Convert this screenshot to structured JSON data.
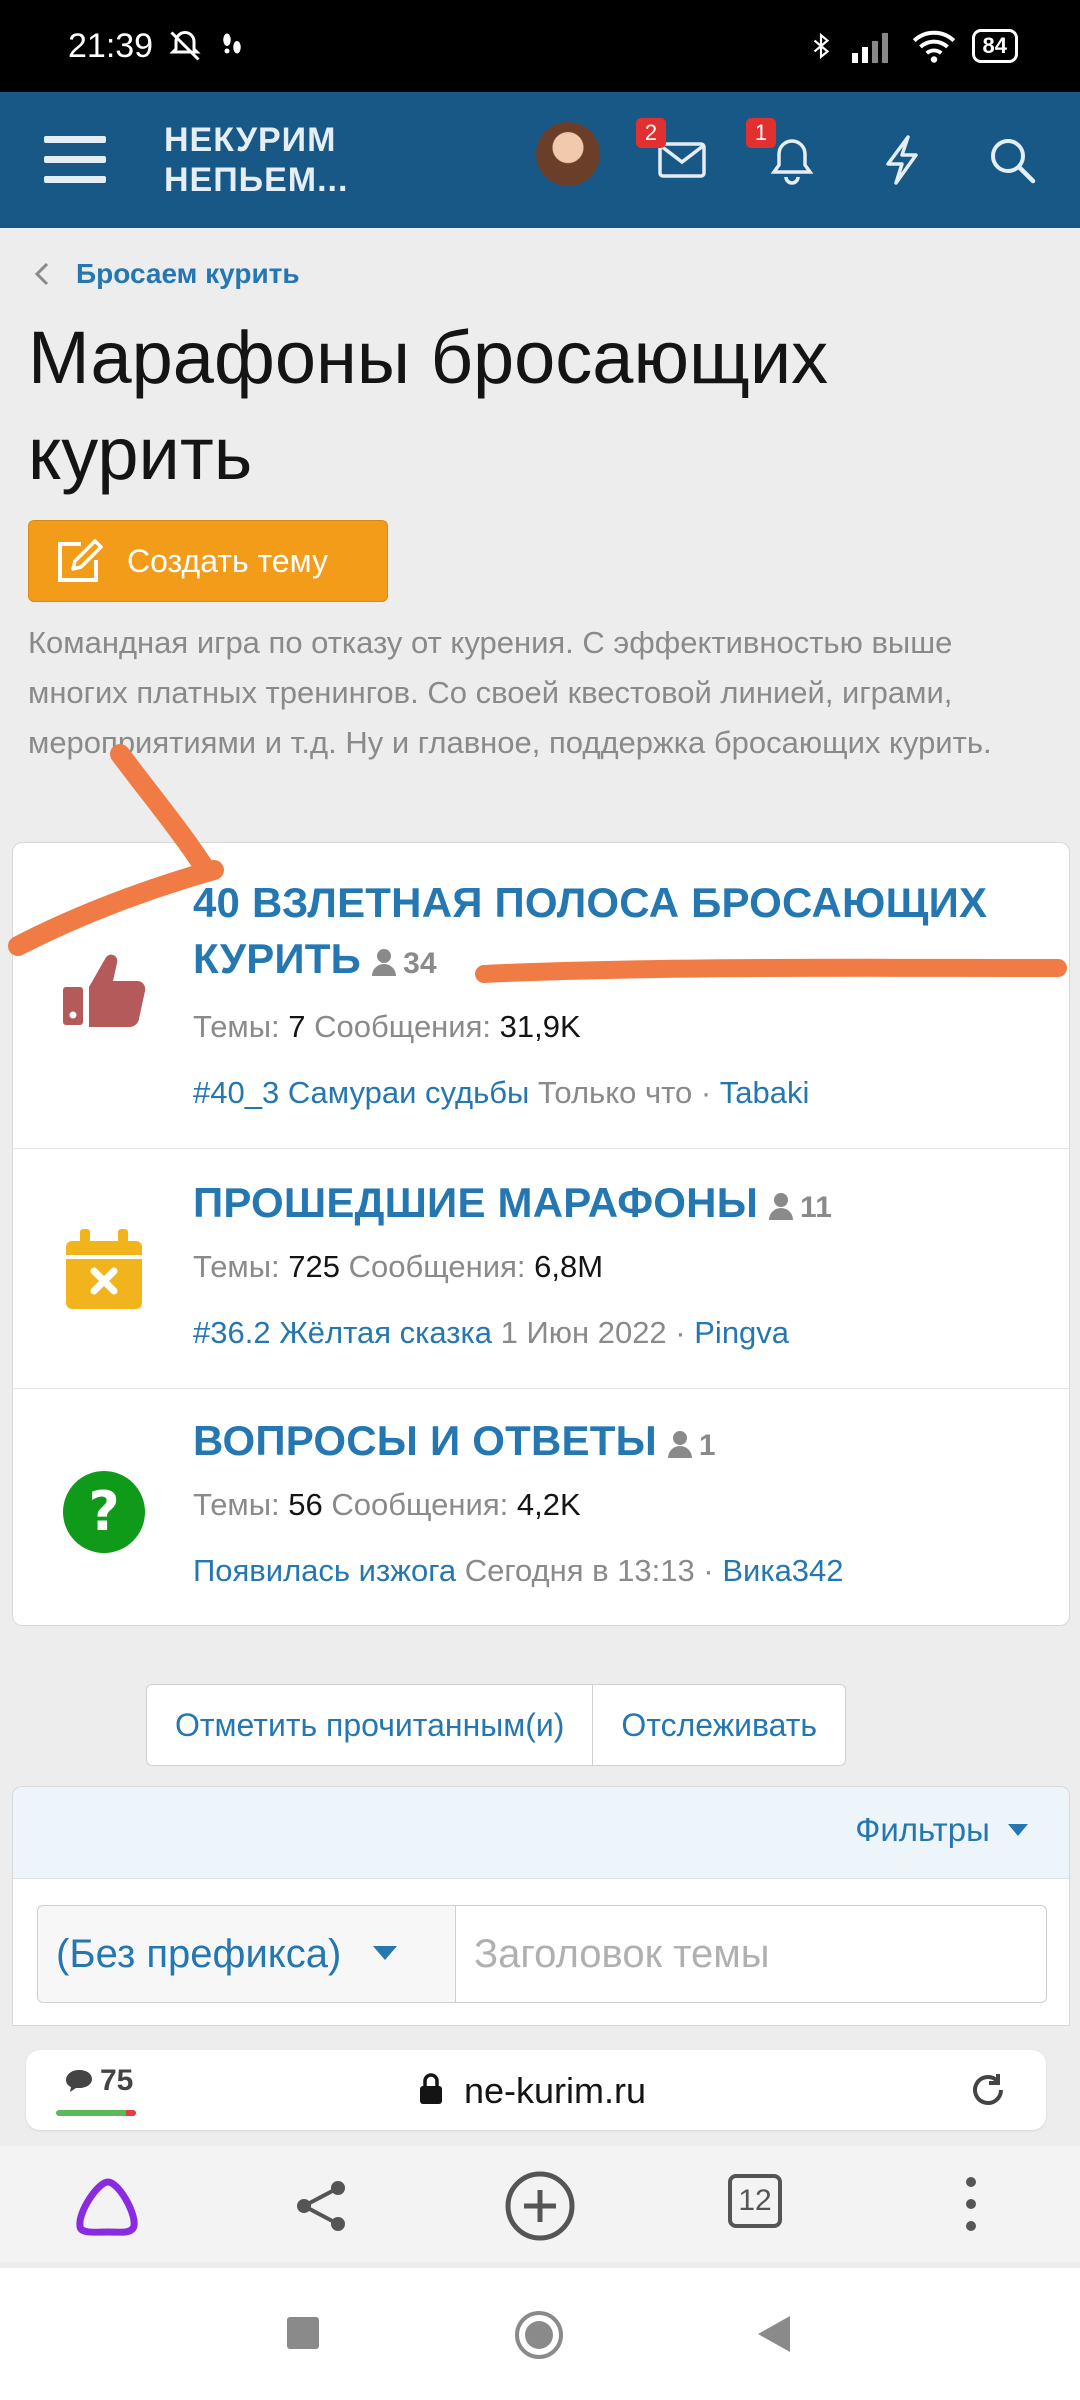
{
  "status_bar": {
    "time": "21:39",
    "battery": "84"
  },
  "header": {
    "logo_line1": "НЕКУРИМ",
    "logo_line2": "НЕПЬЕМ...",
    "messages_badge": "2",
    "alerts_badge": "1"
  },
  "breadcrumb": {
    "label": "Бросаем курить"
  },
  "page": {
    "title": "Марафоны бросающих курить",
    "create_button": "Создать тему",
    "description": "Командная игра по отказу от курения. С эффективностью выше многих платных тренингов. Со своей квестовой линией, играми, мероприятиями и т.д. Ну и главное, поддержка бросающих курить."
  },
  "nodes": [
    {
      "title": "40 ВЗЛЕТНАЯ ПОЛОСА БРОСАЮЩИХ КУРИТЬ",
      "users": "34",
      "stats_label_threads": "Темы:",
      "threads": "7",
      "stats_label_messages": "Сообщения:",
      "messages": "31,9K",
      "last_thread": "#40_3 Самураи судьбы",
      "last_time": "Только что",
      "last_user": "Tabaki",
      "icon": "thumbs-up-icon"
    },
    {
      "title": "ПРОШЕДШИЕ МАРАФОНЫ",
      "users": "11",
      "stats_label_threads": "Темы:",
      "threads": "725",
      "stats_label_messages": "Сообщения:",
      "messages": "6,8M",
      "last_thread": "#36.2 Жёлтая сказка",
      "last_time": "1 Июн 2022",
      "last_user": "Pingva",
      "icon": "calendar-x-icon"
    },
    {
      "title": "ВОПРОСЫ И ОТВЕТЫ",
      "users": "1",
      "stats_label_threads": "Темы:",
      "threads": "56",
      "stats_label_messages": "Сообщения:",
      "messages": "4,2K",
      "last_thread": "Появилась изжога",
      "last_time": "Сегодня в 13:13",
      "last_user": "Вика342",
      "icon": "question-icon"
    }
  ],
  "actions": {
    "mark_read": "Отметить прочитанным(и)",
    "watch": "Отслеживать"
  },
  "filters": {
    "label": "Фильтры",
    "prefix_value": "(Без префикса)",
    "title_placeholder": "Заголовок темы"
  },
  "browser": {
    "comments_count": "75",
    "url": "ne-kurim.ru",
    "tabs_count": "12"
  },
  "colors": {
    "header": "#185886",
    "link": "#2577b1",
    "create_button": "#f29c1a",
    "annotation": "#f07b45"
  }
}
